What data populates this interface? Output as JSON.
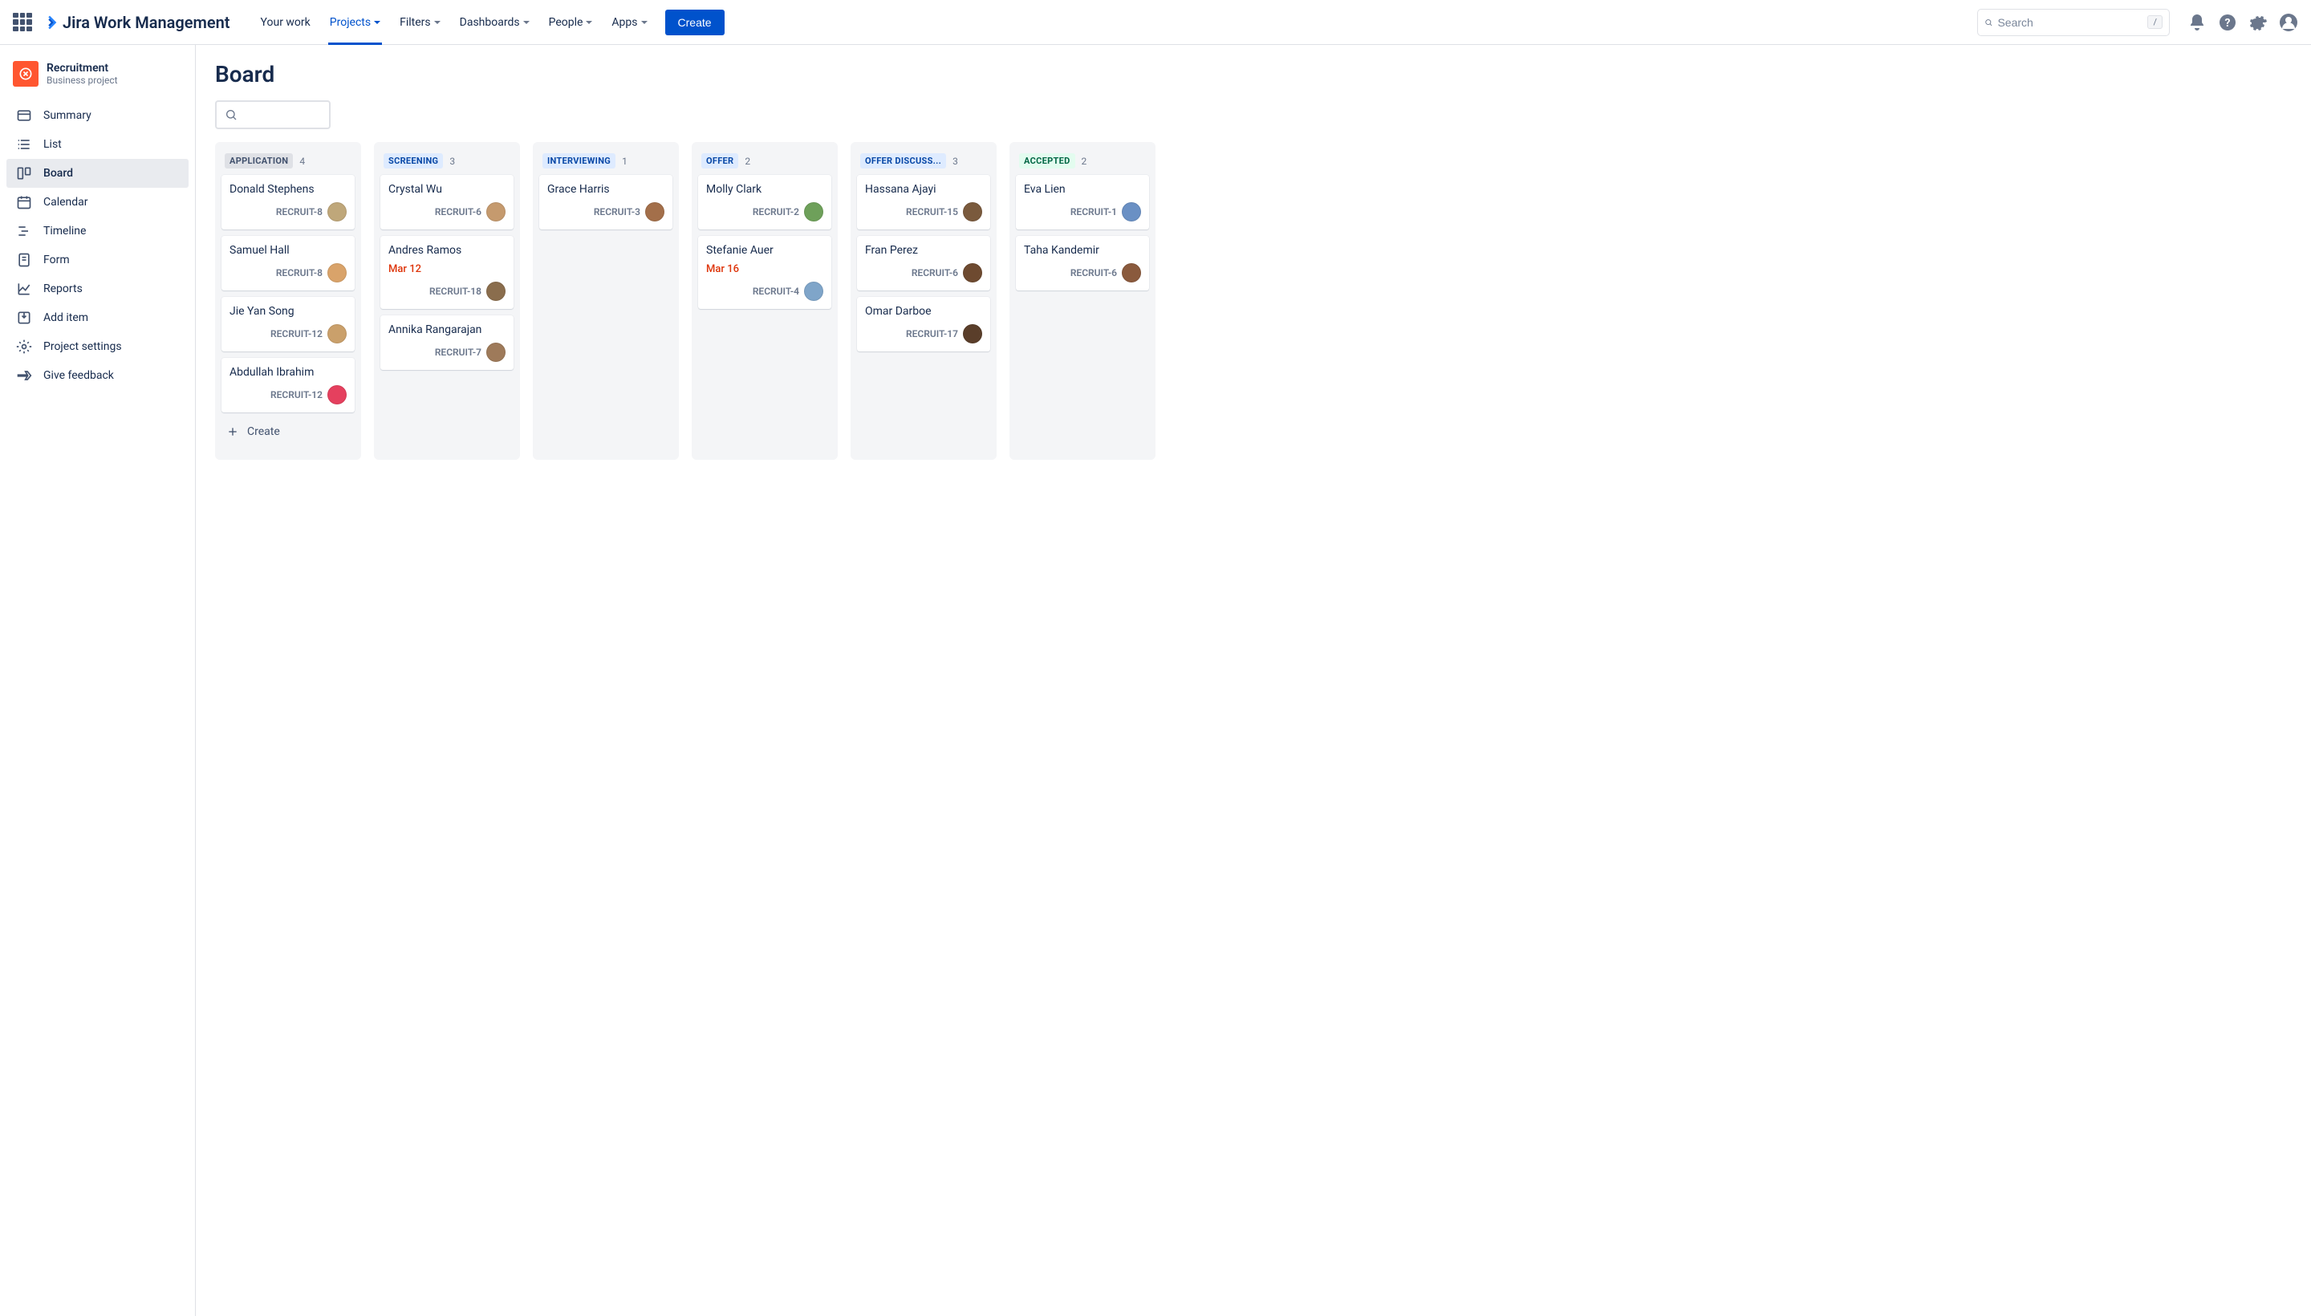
{
  "brand": "Jira Work Management",
  "nav": {
    "your_work": "Your work",
    "projects": "Projects",
    "filters": "Filters",
    "dashboards": "Dashboards",
    "people": "People",
    "apps": "Apps",
    "create": "Create"
  },
  "search": {
    "placeholder": "Search",
    "kbd": "/"
  },
  "project": {
    "name": "Recruitment",
    "type": "Business project"
  },
  "sidebar": [
    {
      "label": "Summary"
    },
    {
      "label": "List"
    },
    {
      "label": "Board"
    },
    {
      "label": "Calendar"
    },
    {
      "label": "Timeline"
    },
    {
      "label": "Form"
    },
    {
      "label": "Reports"
    },
    {
      "label": "Add item"
    },
    {
      "label": "Project settings"
    },
    {
      "label": "Give feedback"
    }
  ],
  "page": {
    "title": "Board",
    "create": "Create"
  },
  "columns": [
    {
      "name": "APPLICATION",
      "count": "4",
      "style": "gray",
      "cards": [
        {
          "title": "Donald Stephens",
          "key": "RECRUIT-8",
          "avatar": "#bfa77a"
        },
        {
          "title": "Samuel Hall",
          "key": "RECRUIT-8",
          "avatar": "#d9a36a"
        },
        {
          "title": "Jie Yan Song",
          "key": "RECRUIT-12",
          "avatar": "#caa06b"
        },
        {
          "title": "Abdullah Ibrahim",
          "key": "RECRUIT-12",
          "avatar": "#e5405e"
        }
      ],
      "show_create": true
    },
    {
      "name": "SCREENING",
      "count": "3",
      "style": "blue",
      "cards": [
        {
          "title": "Crystal Wu",
          "key": "RECRUIT-6",
          "avatar": "#c59a6e"
        },
        {
          "title": "Andres Ramos",
          "date": "Mar 12",
          "key": "RECRUIT-18",
          "avatar": "#8a6d4d"
        },
        {
          "title": "Annika Rangarajan",
          "key": "RECRUIT-7",
          "avatar": "#9e7a5a"
        }
      ]
    },
    {
      "name": "INTERVIEWING",
      "count": "1",
      "style": "blue",
      "cards": [
        {
          "title": "Grace Harris",
          "key": "RECRUIT-3",
          "avatar": "#a36f4a"
        }
      ]
    },
    {
      "name": "OFFER",
      "count": "2",
      "style": "blue",
      "cards": [
        {
          "title": "Molly Clark",
          "key": "RECRUIT-2",
          "avatar": "#6ea05a"
        },
        {
          "title": "Stefanie Auer",
          "date": "Mar 16",
          "key": "RECRUIT-4",
          "avatar": "#7fa5c9"
        }
      ]
    },
    {
      "name": "OFFER DISCUSS...",
      "count": "3",
      "style": "blue",
      "cards": [
        {
          "title": "Hassana Ajayi",
          "key": "RECRUIT-15",
          "avatar": "#7a5a3d"
        },
        {
          "title": "Fran Perez",
          "key": "RECRUIT-6",
          "avatar": "#6e4a30"
        },
        {
          "title": "Omar Darboe",
          "key": "RECRUIT-17",
          "avatar": "#5a3e2a"
        }
      ]
    },
    {
      "name": "ACCEPTED",
      "count": "2",
      "style": "green",
      "cards": [
        {
          "title": "Eva Lien",
          "key": "RECRUIT-1",
          "avatar": "#6a90c4"
        },
        {
          "title": "Taha Kandemir",
          "key": "RECRUIT-6",
          "avatar": "#8a5a3d"
        }
      ]
    }
  ]
}
